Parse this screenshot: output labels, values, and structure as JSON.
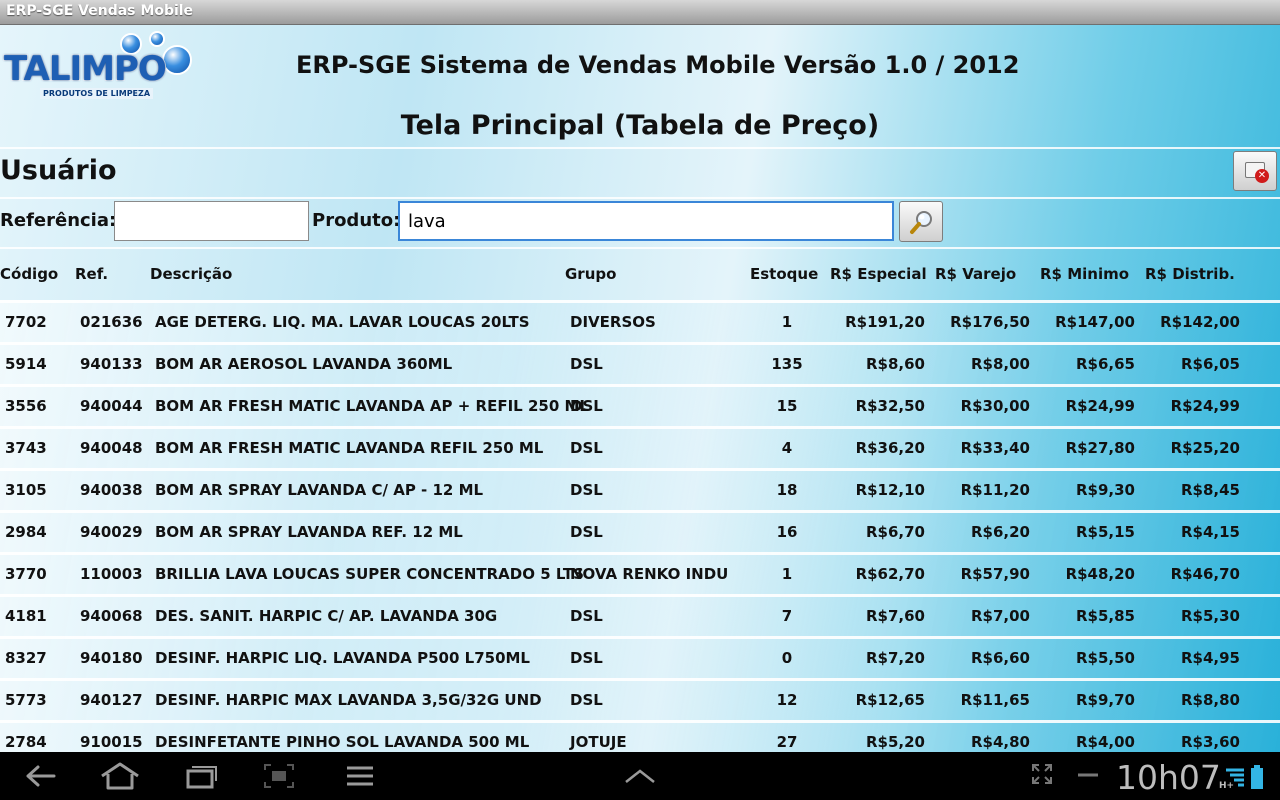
{
  "window": {
    "title": "ERP-SGE Vendas Mobile"
  },
  "logo": {
    "word": "TALIMPO",
    "subtitle": "PRODUTOS DE LIMPEZA"
  },
  "header": {
    "title": "ERP-SGE Sistema de Vendas Mobile Versão 1.0 / 2012",
    "screen_title": "Tela Principal (Tabela de Preço)"
  },
  "user": {
    "label": "Usuário",
    "exit_icon": "exit-icon"
  },
  "search": {
    "referencia_label": "Referência:",
    "referencia_value": "",
    "produto_label": "Produto:",
    "produto_value": "lava",
    "button_icon": "magnifier-icon"
  },
  "table": {
    "headers": [
      "Código",
      "Ref.",
      "Descrição",
      "Grupo",
      "Estoque",
      "R$ Especial",
      "R$ Varejo",
      "R$ Minimo",
      "R$ Distrib."
    ],
    "rows": [
      [
        "7702",
        "021636",
        "AGE DETERG. LIQ. MA. LAVAR LOUCAS 20LTS",
        "DIVERSOS",
        "1",
        "R$191,20",
        "R$176,50",
        "R$147,00",
        "R$142,00"
      ],
      [
        "5914",
        "940133",
        "BOM AR AEROSOL LAVANDA 360ML",
        "DSL",
        "135",
        "R$8,60",
        "R$8,00",
        "R$6,65",
        "R$6,05"
      ],
      [
        "3556",
        "940044",
        "BOM AR FRESH MATIC LAVANDA AP + REFIL 250 ML",
        "DSL",
        "15",
        "R$32,50",
        "R$30,00",
        "R$24,99",
        "R$24,99"
      ],
      [
        "3743",
        "940048",
        "BOM AR FRESH MATIC LAVANDA REFIL 250 ML",
        "DSL",
        "4",
        "R$36,20",
        "R$33,40",
        "R$27,80",
        "R$25,20"
      ],
      [
        "3105",
        "940038",
        "BOM AR SPRAY LAVANDA C/ AP - 12 ML",
        "DSL",
        "18",
        "R$12,10",
        "R$11,20",
        "R$9,30",
        "R$8,45"
      ],
      [
        "2984",
        "940029",
        "BOM AR SPRAY LAVANDA REF. 12 ML",
        "DSL",
        "16",
        "R$6,70",
        "R$6,20",
        "R$5,15",
        "R$4,15"
      ],
      [
        "3770",
        "110003",
        "BRILLIA LAVA LOUCAS SUPER CONCENTRADO 5 LTS",
        "NOVA RENKO INDU",
        "1",
        "R$62,70",
        "R$57,90",
        "R$48,20",
        "R$46,70"
      ],
      [
        "4181",
        "940068",
        "DES. SANIT. HARPIC C/ AP. LAVANDA 30G",
        "DSL",
        "7",
        "R$7,60",
        "R$7,00",
        "R$5,85",
        "R$5,30"
      ],
      [
        "8327",
        "940180",
        "DESINF. HARPIC LIQ. LAVANDA P500 L750ML",
        "DSL",
        "0",
        "R$7,20",
        "R$6,60",
        "R$5,50",
        "R$4,95"
      ],
      [
        "5773",
        "940127",
        "DESINF. HARPIC MAX LAVANDA 3,5G/32G UND",
        "DSL",
        "12",
        "R$12,65",
        "R$11,65",
        "R$9,70",
        "R$8,80"
      ],
      [
        "2784",
        "910015",
        "DESINFETANTE PINHO SOL LAVANDA 500 ML",
        "JOTUJE",
        "27",
        "R$5,20",
        "R$4,80",
        "R$4,00",
        "R$3,60"
      ]
    ]
  },
  "navbar": {
    "icons": [
      "back-icon",
      "home-icon",
      "recent-apps-icon",
      "screenshot-icon",
      "menu-icon",
      "chevron-up-icon",
      "fullscreen-icon",
      "minus-icon",
      "signal-icon",
      "battery-icon"
    ],
    "clock": "10h07",
    "network": "H+"
  }
}
